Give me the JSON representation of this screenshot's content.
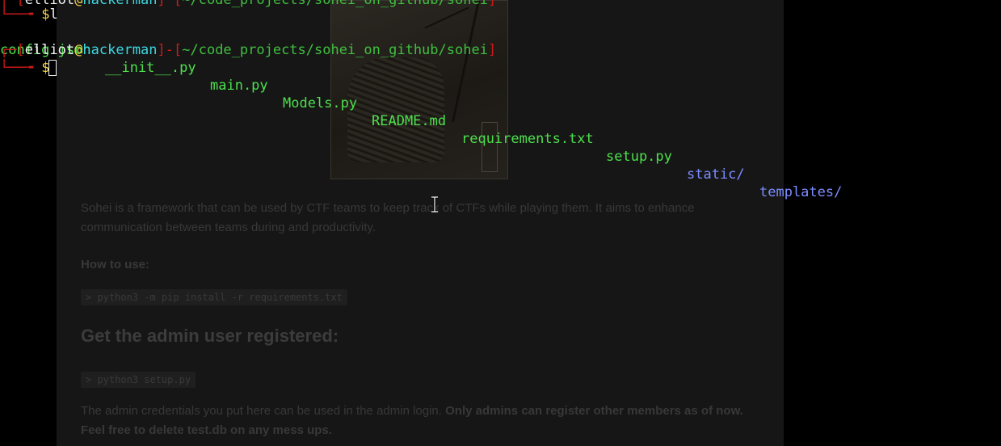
{
  "colors": {
    "bracket": "#d01a1a",
    "user": "#f2f2f2",
    "at": "#f5d547",
    "host": "#3ed6e0",
    "path": "#3fbf3f",
    "file": "#4ce04c",
    "dir": "#7c8cff"
  },
  "terminal": {
    "prev_prompt": {
      "user": "elliot",
      "at": "@",
      "host": "hackerman",
      "path": "~/code_projects/sohei_on_github/sohei"
    },
    "command_line": {
      "dollar": "$",
      "command": "l"
    },
    "ls_output": [
      {
        "name": "config.json",
        "kind": "file"
      },
      {
        "name": "__init__.py",
        "kind": "file"
      },
      {
        "name": "main.py",
        "kind": "file"
      },
      {
        "name": "Models.py",
        "kind": "file"
      },
      {
        "name": "README.md",
        "kind": "file"
      },
      {
        "name": "requirements.txt",
        "kind": "file"
      },
      {
        "name": "setup.py",
        "kind": "file"
      },
      {
        "name": "static/",
        "kind": "dir"
      },
      {
        "name": "templates/",
        "kind": "dir"
      }
    ],
    "current_prompt": {
      "open_bracket": "[",
      "user": "elliot",
      "at": "@",
      "host": "hackerman",
      "sep": "]-[",
      "path": "~/code_projects/sohei_on_github/sohei",
      "close_bracket": "]",
      "dollar": "$"
    }
  },
  "readme": {
    "intro": "Sohei is a framework that can be used by CTF teams to keep track of CTFs while playing them. It aims to enhance communication between teams during and productivity.",
    "how_to_use": "How to use:",
    "install_cmd": "> python3 -m pip install -r requirements.txt",
    "admin_heading": "Get the admin user registered:",
    "setup_cmd": "> python3 setup.py",
    "admin_note_plain": "The admin credentials you put here can be used in the admin login. ",
    "admin_note_bold": "Only admins can register other members as of now. Feel free to delete test.db on any mess ups."
  }
}
